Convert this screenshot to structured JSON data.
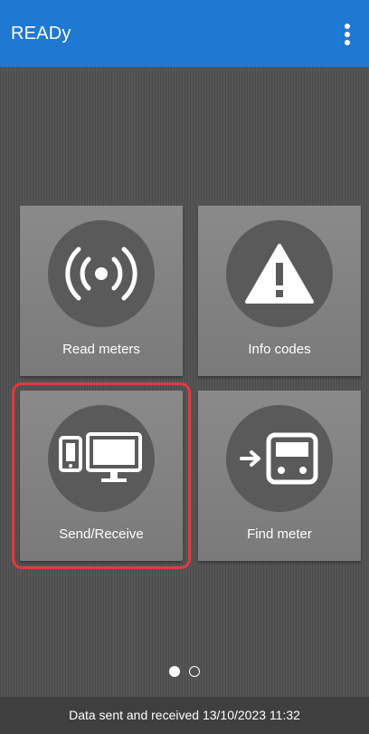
{
  "app_bar": {
    "title": "READy",
    "menu_icon": "more-vert-icon",
    "color": "#1f78d1"
  },
  "tiles": [
    {
      "label": "Read meters",
      "icon": "radio-signal-icon"
    },
    {
      "label": "Info codes",
      "icon": "warning-triangle-icon"
    },
    {
      "label": "Send/Receive",
      "icon": "devices-icon",
      "selected": true
    },
    {
      "label": "Find meter",
      "icon": "find-meter-icon"
    }
  ],
  "pager": {
    "pages": 2,
    "current": 1
  },
  "status": {
    "text": "Data sent and received 13/10/2023 11:32"
  },
  "colors": {
    "background": "#555555",
    "tile": "#808080",
    "tile_circle": "#5a5a5a",
    "highlight": "#e23a3f",
    "status_bar": "#3f3f3f"
  }
}
